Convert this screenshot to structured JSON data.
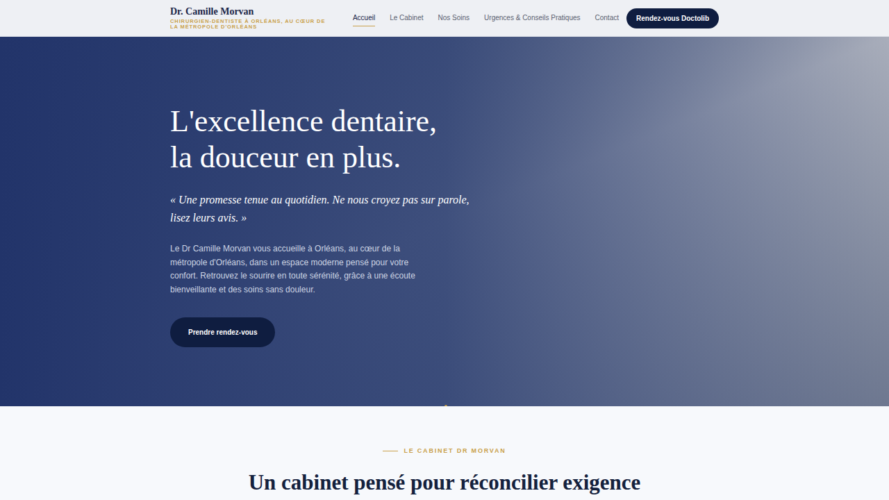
{
  "header": {
    "brand": "Dr. Camille Morvan",
    "tagline": "CHIRURGIEN-DENTISTE À ORLÉANS, AU CŒUR DE LA MÉTROPOLE D'ORLÉANS",
    "nav": [
      {
        "label": "Accueil",
        "selected": true
      },
      {
        "label": "Le Cabinet",
        "selected": false
      },
      {
        "label": "Nos Soins",
        "selected": false
      },
      {
        "label": "Urgences & Conseils Pratiques",
        "selected": false
      },
      {
        "label": "Contact",
        "selected": false
      }
    ],
    "cta": "Rendez-vous Doctolib"
  },
  "hero": {
    "title_lines": [
      "L'excellence dentaire,",
      "la douceur en plus."
    ],
    "quote": "« Une promesse tenue au quotidien. Ne nous croyez pas sur parole, lisez leurs avis. »",
    "body": "Le Dr Camille Morvan vous accueille à Orléans, au cœur de la métropole d'Orléans, dans un espace moderne pensé pour votre confort. Retrouvez le sourire en toute sérénité, grâce à une écoute bienveillante et des soins sans douleur.",
    "button": "Prendre rendez-vous"
  },
  "section": {
    "eyebrow": "LE CABINET DR MORVAN",
    "heading": "Un cabinet pensé pour réconcilier exigence"
  }
}
